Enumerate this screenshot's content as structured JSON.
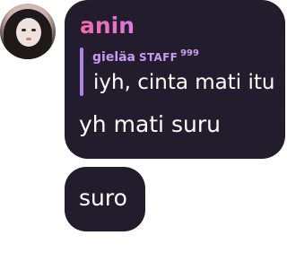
{
  "message": {
    "username": "anin",
    "reply": {
      "author": "gieläa",
      "badge": "STAFF",
      "badge_count": "999",
      "text": "iyh, cinta mati itu"
    },
    "text": "yh mati suru"
  },
  "followup": {
    "text": "suro"
  },
  "colors": {
    "bubble": "#231c2c",
    "username_gradient_start": "#f46aa8",
    "username_gradient_end": "#d97be0",
    "reply_accent": "#c79bf0",
    "text": "#ffffff"
  },
  "icons": {
    "avatar": "user-avatar-photo"
  }
}
